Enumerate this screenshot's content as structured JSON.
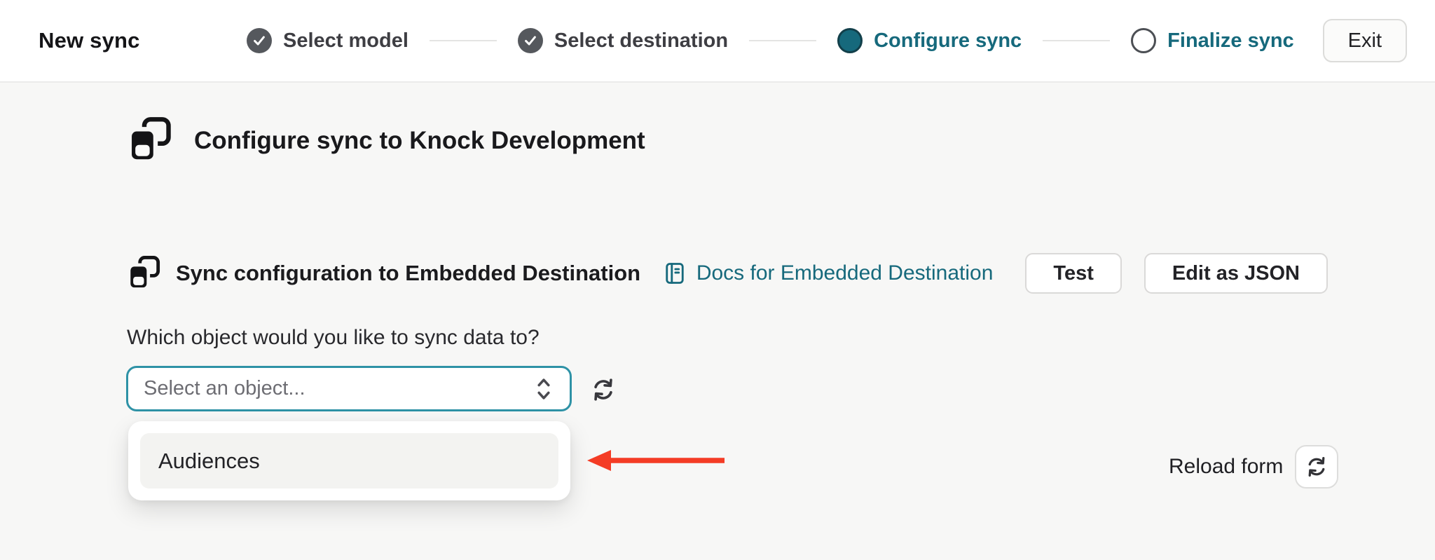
{
  "header": {
    "title": "New sync",
    "steps": [
      {
        "label": "Select model",
        "state": "complete"
      },
      {
        "label": "Select destination",
        "state": "complete"
      },
      {
        "label": "Configure sync",
        "state": "current"
      },
      {
        "label": "Finalize sync",
        "state": "upcoming"
      }
    ],
    "exit_label": "Exit"
  },
  "main": {
    "page_title": "Configure sync to Knock Development",
    "section": {
      "title": "Sync configuration to Embedded Destination",
      "docs_link_label": "Docs for Embedded Destination",
      "test_button_label": "Test",
      "edit_json_button_label": "Edit as JSON"
    },
    "object_question": "Which object would you like to sync data to?",
    "object_select": {
      "placeholder": "Select an object..."
    },
    "dropdown": {
      "options": [
        "Audiences"
      ]
    },
    "reload_form_label": "Reload form"
  },
  "icons": {
    "step_complete": "check-icon",
    "step_current": "filled-dot",
    "step_upcoming": "empty-circle",
    "page_heading": "destination-card-icon",
    "docs": "book-icon",
    "select": "chevron-up-down-icon",
    "refresh": "refresh-arrows-icon",
    "annotation": "red-arrow-left"
  },
  "colors": {
    "accent_teal": "#16697c",
    "select_border_teal": "#2e92a6",
    "arrow_red": "#f43c25",
    "step_complete_gray": "#55585d",
    "page_background": "#f7f7f6",
    "topbar_background": "#ffffff"
  }
}
